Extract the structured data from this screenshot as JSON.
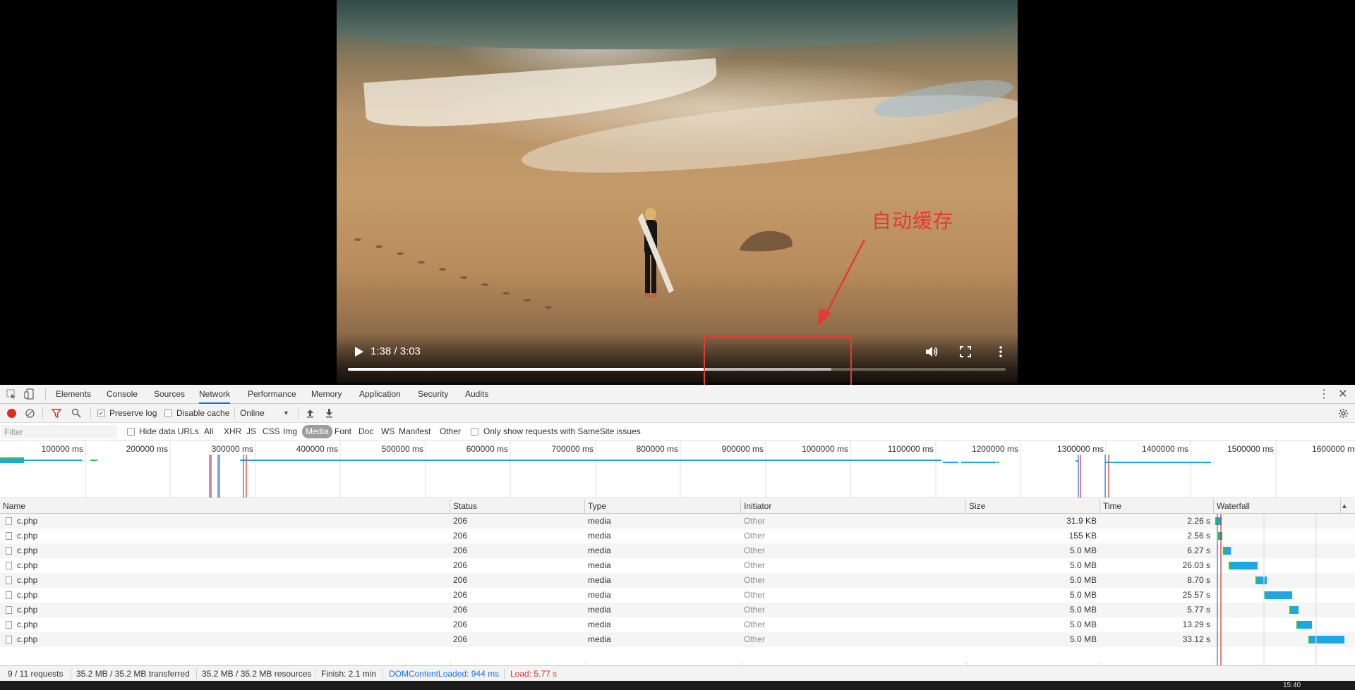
{
  "video": {
    "time": "1:38 / 3:03",
    "played_fraction": 0.544,
    "buffered_fraction": 0.735,
    "annotation": "自动缓存",
    "annotation_color": "#e53935"
  },
  "devtools": {
    "tabs": [
      "Elements",
      "Console",
      "Sources",
      "Network",
      "Performance",
      "Memory",
      "Application",
      "Security",
      "Audits"
    ],
    "active_tab": "Network",
    "toolbar": {
      "preserve_log": "Preserve log",
      "disable_cache": "Disable cache",
      "throttle": "Online"
    },
    "filter": {
      "placeholder": "Filter",
      "hide_data_urls": "Hide data URLs",
      "types": [
        "All",
        "XHR",
        "JS",
        "CSS",
        "Img",
        "Media",
        "Font",
        "Doc",
        "WS",
        "Manifest",
        "Other"
      ],
      "active_type": "Media",
      "samesite": "Only show requests with SameSite issues"
    },
    "overview_ticks": [
      "100000 ms",
      "200000 ms",
      "300000 ms",
      "400000 ms",
      "500000 ms",
      "600000 ms",
      "700000 ms",
      "800000 ms",
      "900000 ms",
      "1000000 ms",
      "1100000 ms",
      "1200000 ms",
      "1300000 ms",
      "1400000 ms",
      "1500000 ms",
      "1600000 ms"
    ],
    "columns": [
      "Name",
      "Status",
      "Type",
      "Initiator",
      "Size",
      "Time",
      "Waterfall"
    ],
    "requests": [
      {
        "name": "c.php",
        "status": "206",
        "type": "media",
        "initiator": "Other",
        "size": "31.9 KB",
        "time": "2.26 s"
      },
      {
        "name": "c.php",
        "status": "206",
        "type": "media",
        "initiator": "Other",
        "size": "155 KB",
        "time": "2.56 s"
      },
      {
        "name": "c.php",
        "status": "206",
        "type": "media",
        "initiator": "Other",
        "size": "5.0 MB",
        "time": "6.27 s"
      },
      {
        "name": "c.php",
        "status": "206",
        "type": "media",
        "initiator": "Other",
        "size": "5.0 MB",
        "time": "26.03 s"
      },
      {
        "name": "c.php",
        "status": "206",
        "type": "media",
        "initiator": "Other",
        "size": "5.0 MB",
        "time": "8.70 s"
      },
      {
        "name": "c.php",
        "status": "206",
        "type": "media",
        "initiator": "Other",
        "size": "5.0 MB",
        "time": "25.57 s"
      },
      {
        "name": "c.php",
        "status": "206",
        "type": "media",
        "initiator": "Other",
        "size": "5.0 MB",
        "time": "5.77 s"
      },
      {
        "name": "c.php",
        "status": "206",
        "type": "media",
        "initiator": "Other",
        "size": "5.0 MB",
        "time": "13.29 s"
      },
      {
        "name": "c.php",
        "status": "206",
        "type": "media",
        "initiator": "Other",
        "size": "5.0 MB",
        "time": "33.12 s"
      }
    ],
    "status": {
      "requests": "9 / 11 requests",
      "transferred": "35.2 MB / 35.2 MB transferred",
      "resources": "35.2 MB / 35.2 MB resources",
      "finish": "Finish: 2.1 min",
      "dcl": "DOMContentLoaded: 944 ms",
      "load": "Load: 5.77 s"
    },
    "colors": {
      "accent": "#1a73e8",
      "dcl": "#1a73e8",
      "load": "#d93025",
      "waterfall_download": "#1ea7e8",
      "waterfall_wait": "#2ebd59"
    }
  },
  "clock": "15:40"
}
